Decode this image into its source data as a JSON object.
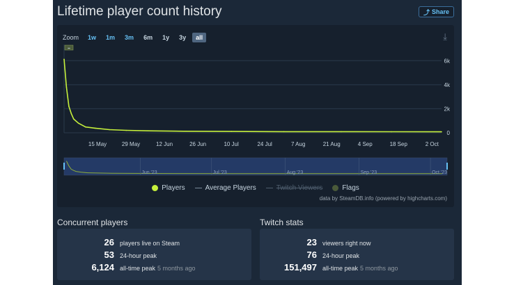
{
  "header": {
    "title": "Lifetime player count history",
    "share_label": "Share"
  },
  "zoom": {
    "label": "Zoom",
    "buttons": [
      "1w",
      "1m",
      "3m",
      "6m",
      "1y",
      "3y",
      "all"
    ],
    "active": "all"
  },
  "chart_data": {
    "type": "line",
    "y_ticks": [
      "0",
      "2k",
      "4k",
      "6k"
    ],
    "x_tick_labels": [
      "15 May",
      "29 May",
      "12 Jun",
      "26 Jun",
      "10 Jul",
      "24 Jul",
      "7 Aug",
      "21 Aug",
      "4 Sep",
      "18 Sep",
      "2 Oct"
    ],
    "ylim": [
      0,
      7000
    ],
    "xlim": [
      "2023-05-01",
      "2023-10-06"
    ],
    "series": [
      {
        "name": "Players",
        "color": "#c6f03c",
        "x": [
          "2023-05-01",
          "2023-05-02",
          "2023-05-03",
          "2023-05-04",
          "2023-05-05",
          "2023-05-07",
          "2023-05-10",
          "2023-05-14",
          "2023-05-20",
          "2023-05-27",
          "2023-06-05",
          "2023-06-20",
          "2023-07-10",
          "2023-08-01",
          "2023-08-25",
          "2023-09-15",
          "2023-10-06"
        ],
        "values": [
          6124,
          3800,
          2200,
          1600,
          1150,
          800,
          480,
          380,
          260,
          200,
          160,
          130,
          110,
          95,
          90,
          85,
          80
        ]
      }
    ],
    "flags": [
      {
        "x": "2023-05-01",
        "label": "▪▪"
      }
    ],
    "navigator_labels": [
      "Jun '23",
      "Jul '23",
      "Aug '23",
      "Sep '23",
      "Oct '23"
    ],
    "legend": [
      {
        "name": "Players",
        "color": "#c6f03c",
        "symbol": "dot",
        "enabled": true
      },
      {
        "name": "Average Players",
        "color": "#7a8a9a",
        "symbol": "line",
        "enabled": true
      },
      {
        "name": "Twitch Viewers",
        "color": "#4e5d6d",
        "symbol": "line",
        "enabled": false
      },
      {
        "name": "Flags",
        "color": "#4a5a3a",
        "symbol": "dot",
        "enabled": true
      }
    ]
  },
  "credit": "data by SteamDB.info (powered by highcharts.com)",
  "concurrent": {
    "title": "Concurrent players",
    "rows": [
      {
        "value": "26",
        "label": "players live on Steam",
        "sub": ""
      },
      {
        "value": "53",
        "label": "24-hour peak",
        "sub": ""
      },
      {
        "value": "6,124",
        "label": "all-time peak",
        "sub": "5 months ago"
      }
    ]
  },
  "twitch": {
    "title": "Twitch stats",
    "rows": [
      {
        "value": "23",
        "label": "viewers right now",
        "sub": ""
      },
      {
        "value": "76",
        "label": "24-hour peak",
        "sub": ""
      },
      {
        "value": "151,497",
        "label": "all-time peak",
        "sub": "5 months ago"
      }
    ]
  }
}
